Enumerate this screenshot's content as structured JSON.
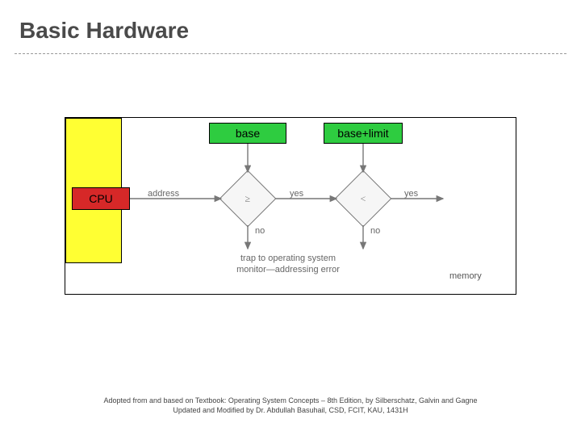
{
  "title": "Basic Hardware",
  "diagram": {
    "cpu": "CPU",
    "base": "base",
    "limit": "base+limit",
    "memory_label": "memory",
    "d1_op": "≥",
    "d2_op": "<",
    "label_address": "address",
    "label_yes": "yes",
    "label_no": "no",
    "trap_line1": "trap to operating system",
    "trap_line2": "monitor—addressing error"
  },
  "footer": {
    "line1": "Adopted from and based on Textbook: Operating System Concepts – 8th Edition, by Silberschatz, Galvin and Gagne",
    "line2": "Updated and Modified by Dr. Abdullah Basuhail, CSD, FCIT, KAU, 1431H"
  }
}
